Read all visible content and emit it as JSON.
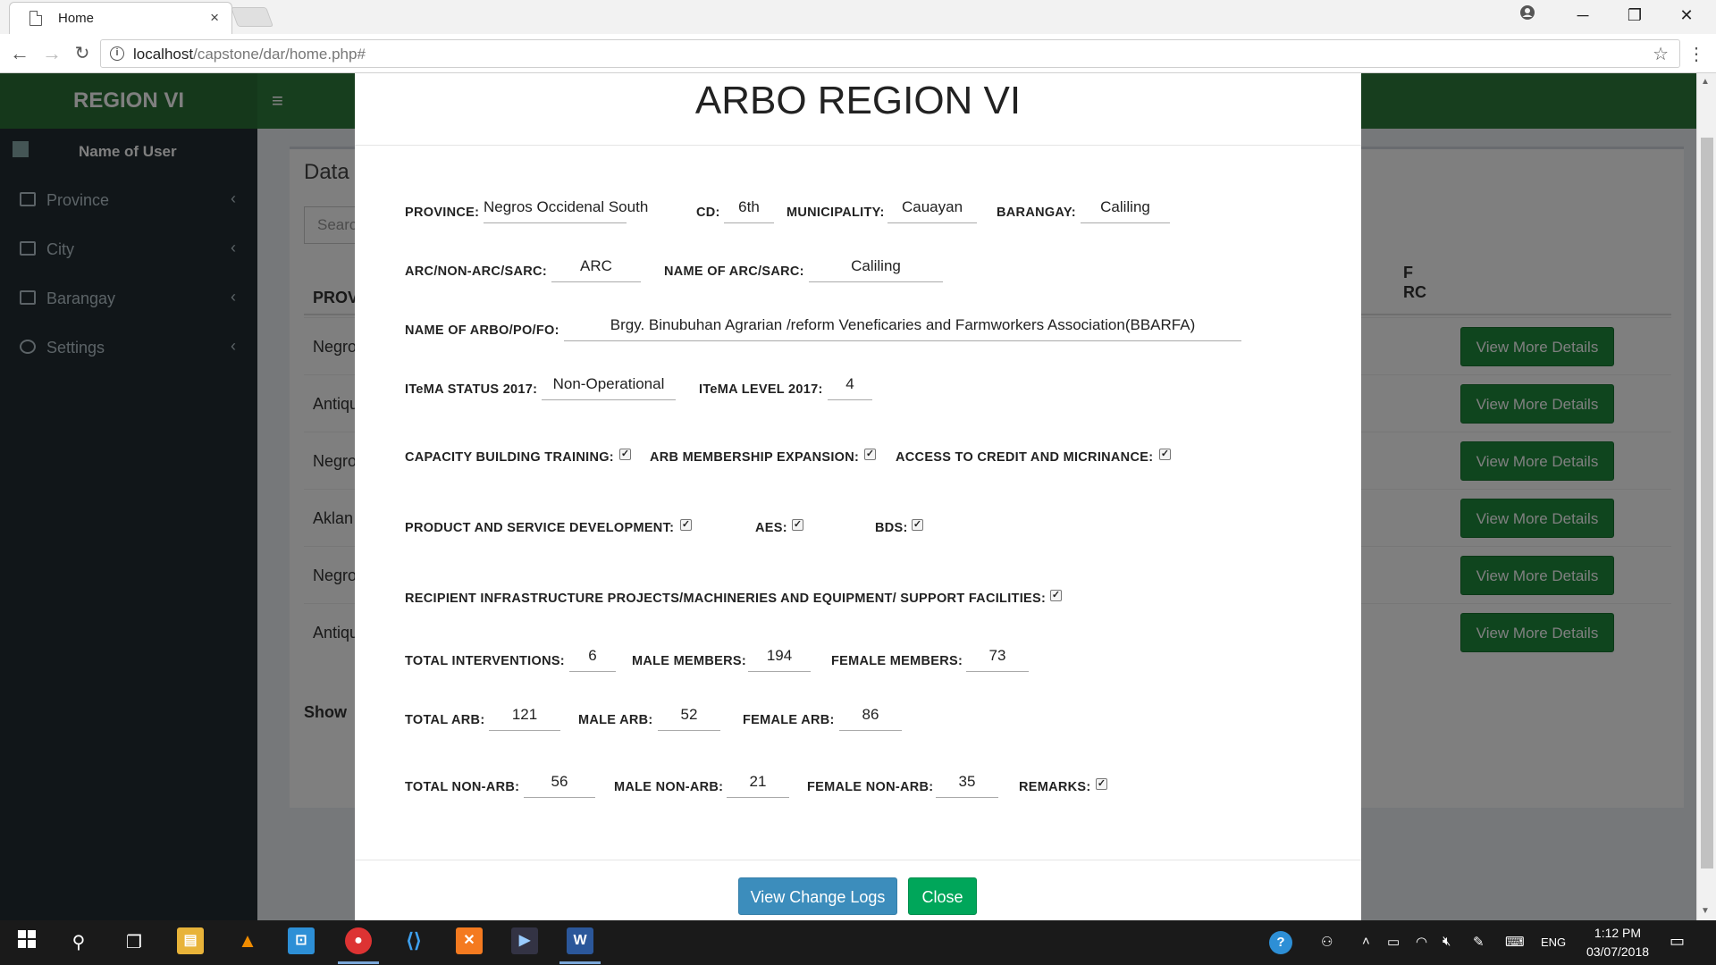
{
  "browser": {
    "tab_title": "Home",
    "url_host": "localhost",
    "url_path": "/capstone/dar/home.php#",
    "tab_close": "×",
    "win_min": "─",
    "win_restore": "❐",
    "win_close": "✕"
  },
  "app": {
    "brand": "REGION VI",
    "user_name": "Name of User",
    "sidebar_items": [
      "Province",
      "City",
      "Barangay",
      "Settings"
    ],
    "box_title": "Data T",
    "search_placeholder": "Searc",
    "table_header_first": "PROV",
    "table_header_last_1": "F",
    "table_header_last_2": "RC",
    "rows": [
      "Negro",
      "Antiqu",
      "Negro",
      "Aklan",
      "Negro",
      "Antiqu"
    ],
    "view_button": "View More Details",
    "show_label": "Show"
  },
  "modal": {
    "title": "ARBO REGION VI",
    "labels": {
      "province": "PROVINCE:",
      "cd": "CD:",
      "municipality": "MUNICIPALITY:",
      "barangay": "BARANGAY:",
      "arc_type": "ARC/NON-ARC/SARC:",
      "arc_name": "NAME OF ARC/SARC:",
      "arbo_name": "NAME OF ARBO/PO/FO:",
      "itema_status": "ITeMA STATUS 2017:",
      "itema_level": "ITeMA LEVEL 2017:",
      "capacity": "CAPACITY BUILDING TRAINING:",
      "arb_membership": "ARB MEMBERSHIP EXPANSION:",
      "access_credit": "ACCESS TO CREDIT AND MICRINANCE:",
      "product_service": "PRODUCT AND SERVICE DEVELOPMENT:",
      "aes": "AES:",
      "bds": "BDS:",
      "recipient": "RECIPIENT INFRASTRUCTURE PROJECTS/MACHINERIES AND EQUIPMENT/ SUPPORT FACILITIES:",
      "total_interventions": "TOTAL INTERVENTIONS:",
      "male_members": "MALE MEMBERS:",
      "female_members": "FEMALE MEMBERS:",
      "total_arb": "TOTAL ARB:",
      "male_arb": "MALE ARB:",
      "female_arb": "FEMALE ARB:",
      "total_non_arb": "TOTAL NON-ARB:",
      "male_non_arb": "MALE NON-ARB:",
      "female_non_arb": "FEMALE NON-ARB:",
      "remarks": "REMARKS:"
    },
    "values": {
      "province": "Negros Occidenal South",
      "cd": "6th",
      "municipality": "Cauayan",
      "barangay": "Caliling",
      "arc_type": "ARC",
      "arc_name": "Caliling",
      "arbo_name": "Brgy. Binubuhan Agrarian /reform Veneficaries and Farmworkers Association(BBARFA)",
      "itema_status": "Non-Operational",
      "itema_level": "4",
      "total_interventions": "6",
      "male_members": "194",
      "female_members": "73",
      "total_arb": "121",
      "male_arb": "52",
      "female_arb": "86",
      "total_non_arb": "56",
      "male_non_arb": "21",
      "female_non_arb": "35"
    },
    "checks": {
      "capacity": true,
      "arb_membership": true,
      "access_credit": true,
      "product_service": true,
      "aes": true,
      "bds": true,
      "recipient": true,
      "remarks": true
    },
    "btn_change_logs": "View Change Logs",
    "btn_close": "Close",
    "colors": {
      "primary": "#3c8dbc",
      "success": "#00a65a"
    }
  },
  "taskbar": {
    "time": "1:12 PM",
    "date": "03/07/2018",
    "lang": "ENG"
  }
}
